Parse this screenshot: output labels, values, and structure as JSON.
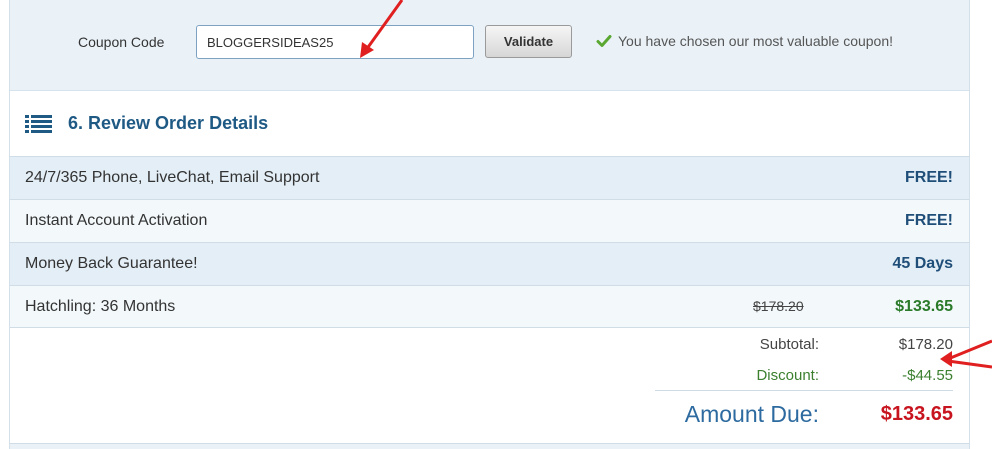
{
  "coupon": {
    "label": "Coupon Code",
    "value": "BLOGGERSIDEAS25",
    "validate_label": "Validate",
    "status_text": "You have chosen our most valuable coupon!"
  },
  "review": {
    "title": "6. Review Order Details",
    "items": [
      {
        "label": "24/7/365 Phone, LiveChat, Email Support",
        "value": "FREE!"
      },
      {
        "label": "Instant Account Activation",
        "value": "FREE!"
      },
      {
        "label": "Money Back Guarantee!",
        "value": "45 Days"
      },
      {
        "label": "Hatchling: 36 Months",
        "original_price": "$178.20",
        "value": "$133.65"
      }
    ]
  },
  "totals": {
    "subtotal_label": "Subtotal:",
    "subtotal_value": "$178.20",
    "discount_label": "Discount:",
    "discount_value": "-$44.55",
    "amount_due_label": "Amount Due:",
    "amount_due_value": "$133.65"
  },
  "colors": {
    "heading": "#1f5a85",
    "amount_due": "#c8141e",
    "discount": "#3b7f2f",
    "annotation_arrow": "#e02020"
  }
}
